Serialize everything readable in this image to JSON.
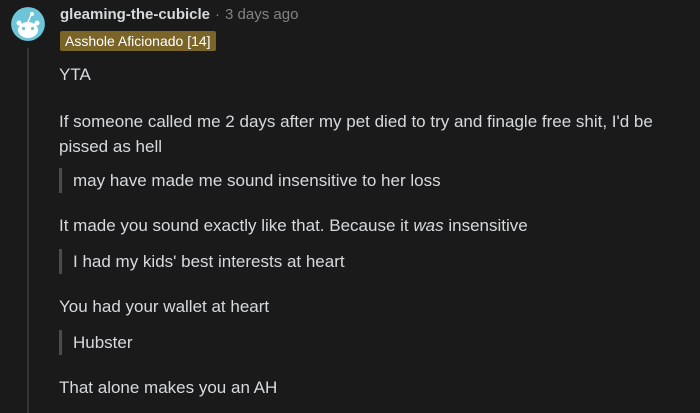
{
  "comment": {
    "username": "gleaming-the-cubicle",
    "separator": "·",
    "timestamp": "3 days ago",
    "flair": "Asshole Aficionado [14]",
    "paragraphs": [
      {
        "type": "text",
        "text": "YTA"
      },
      {
        "type": "text",
        "text": "If someone called me 2 days after my pet died to try and finagle free shit, I'd be pissed as hell"
      },
      {
        "type": "quote",
        "text": "may have made me sound insensitive to her loss"
      },
      {
        "type": "text",
        "pre": "It made you sound exactly like that. Because it ",
        "em": "was",
        "post": " insensitive"
      },
      {
        "type": "quote",
        "text": "I had my kids' best interests at heart"
      },
      {
        "type": "text",
        "text": "You had your wallet at heart"
      },
      {
        "type": "quote",
        "text": "Hubster"
      },
      {
        "type": "text",
        "text": "That alone makes you an AH"
      }
    ]
  },
  "colors": {
    "background": "#1a1a1b",
    "text": "#d7dadc",
    "meta": "#818384",
    "flair_bg": "#7a6428",
    "avatar_bg": "#6dc5d7"
  },
  "icons": {
    "avatar": "reddit-snoo-avatar-icon"
  }
}
